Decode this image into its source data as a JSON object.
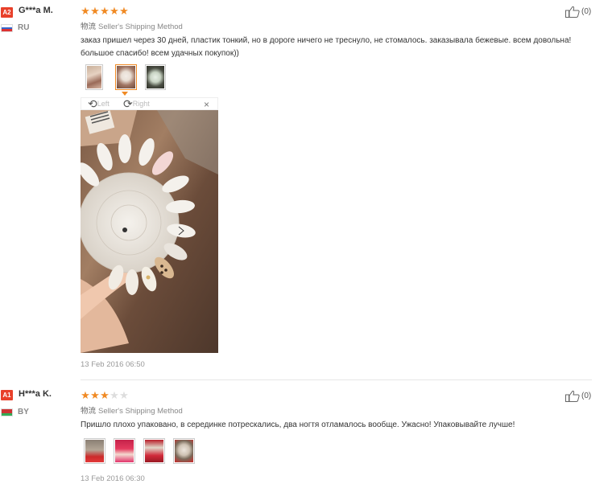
{
  "reviews": [
    {
      "level": "A2",
      "name": "G***a M.",
      "country": "RU",
      "flag_colors": [
        "#ffffff",
        "#3366cc",
        "#dd3333"
      ],
      "rating": 5,
      "star_glyph": "★",
      "ship_key": "物流",
      "ship_method": "Seller's Shipping Method",
      "helpful_count": "(0)",
      "text": "заказ пришел через 30 дней, пластик тонкий, но в дороге ничего не треснуло, не стомалось. заказывала бежевые. всем довольна! большое спасибо! всем удачных покупок))",
      "thumbnails": 3,
      "active_thumbnail": 2,
      "viewer": {
        "left_label": "Left",
        "right_label": "Right",
        "close_glyph": "×"
      },
      "date": "13 Feb 2016 06:50"
    },
    {
      "level": "A1",
      "name": "H***a K.",
      "country": "BY",
      "flag_colors": [
        "#cc3333",
        "#cc3333",
        "#33aa55"
      ],
      "rating": 3,
      "star_glyph": "★",
      "ship_key": "物流",
      "ship_method": "Seller's Shipping Method",
      "helpful_count": "(0)",
      "text": "Пришло плохо упаковано, в серединке потрескались, два ногтя отламалось вообще. Ужасно! Упаковывайте лучше!",
      "thumbnails": 4,
      "date": "13 Feb 2016 06:30"
    }
  ],
  "colors": {
    "star_on": "#f08a24",
    "star_off": "#dddddd",
    "badge": "#e8402a"
  }
}
